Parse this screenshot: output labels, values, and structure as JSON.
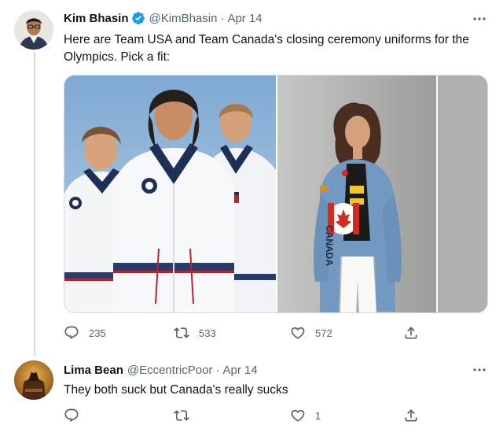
{
  "tweets": [
    {
      "author_name": "Kim Bhasin",
      "verified": true,
      "handle": "@KimBhasin",
      "separator": "·",
      "date": "Apr 14",
      "text": "Here are Team USA and Team Canada's closing ceremony uniforms for the Olympics. Pick a fit:",
      "media_icons": [
        "team-usa-uniforms-photo",
        "team-canada-uniform-photo",
        "third-photo-partial"
      ],
      "canada_jacket_lettering": "CANADA",
      "stats": {
        "replies": "235",
        "retweets": "533",
        "likes": "572"
      }
    },
    {
      "author_name": "Lima Bean",
      "handle": "@EccentricPoor",
      "separator": "·",
      "date": "Apr 14",
      "text": "They both suck but Canada's really sucks",
      "stats": {
        "replies": "",
        "retweets": "",
        "likes": "1"
      }
    }
  ],
  "icons": {
    "more": "more-icon",
    "reply": "reply-icon",
    "retweet": "retweet-icon",
    "like": "like-icon",
    "share": "share-icon",
    "verified": "verified-icon"
  },
  "colors": {
    "text": "#0f1419",
    "secondary": "#536471",
    "verified": "#1d9bf0",
    "divider": "#cfd9de"
  }
}
